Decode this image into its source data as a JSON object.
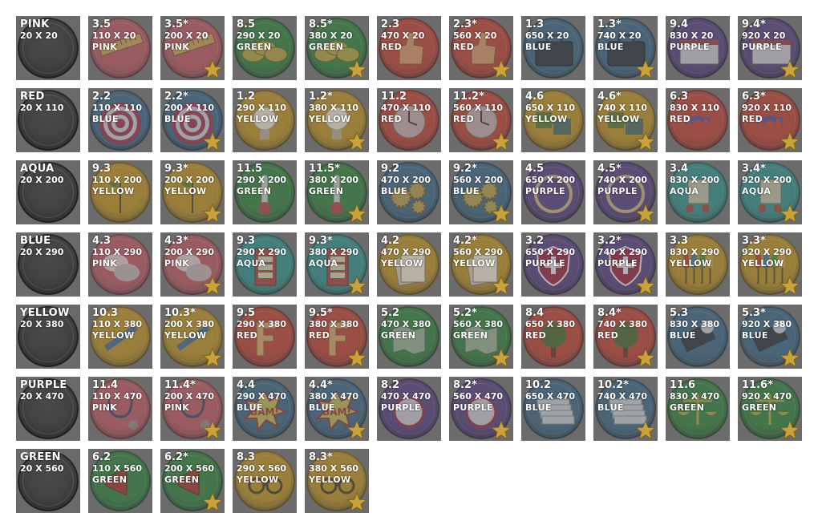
{
  "colors": {
    "tile_bg": "#6a6a6a",
    "PINK": "#b5525a",
    "RED": "#b63a2c",
    "AQUA": "#2c8a86",
    "BLUE": "#35607e",
    "YELLOW": "#b58a1c",
    "PURPLE": "#4f3978",
    "GREEN": "#2a7a36",
    "star": "#c9a23a",
    "empty_disc": "#3a3a3a"
  },
  "rows": [
    {
      "header": {
        "label": "PINK",
        "size": "20 X 20"
      },
      "cells": [
        {
          "code": "3.5",
          "size": "110 X 20",
          "color": "PINK",
          "icon": "ruler-icon"
        },
        {
          "code": "3.5*",
          "size": "200 X 20",
          "color": "PINK",
          "icon": "ruler-icon"
        },
        {
          "code": "8.5",
          "size": "290 X 20",
          "color": "GREEN",
          "icon": "coins-icon"
        },
        {
          "code": "8.5*",
          "size": "380 X 20",
          "color": "GREEN",
          "icon": "coins-icon"
        },
        {
          "code": "2.3",
          "size": "470 X 20",
          "color": "RED",
          "icon": "thumbs-up-icon"
        },
        {
          "code": "2.3*",
          "size": "560 X 20",
          "color": "RED",
          "icon": "thumbs-up-icon"
        },
        {
          "code": "1.3",
          "size": "650 X 20",
          "color": "BLUE",
          "icon": "briefcase-icon"
        },
        {
          "code": "1.3*",
          "size": "740 X 20",
          "color": "BLUE",
          "icon": "briefcase-icon"
        },
        {
          "code": "9.4",
          "size": "830 X 20",
          "color": "PURPLE",
          "icon": "book-icon"
        },
        {
          "code": "9.4*",
          "size": "920 X 20",
          "color": "PURPLE",
          "icon": "book-icon"
        }
      ]
    },
    {
      "header": {
        "label": "RED",
        "size": "20 X 110"
      },
      "cells": [
        {
          "code": "2.2",
          "size": "110 X 110",
          "color": "BLUE",
          "icon": "target-icon"
        },
        {
          "code": "2.2*",
          "size": "200 X 110",
          "color": "BLUE",
          "icon": "target-icon"
        },
        {
          "code": "1.2",
          "size": "290 X 110",
          "color": "YELLOW",
          "icon": "lightbulb-icon"
        },
        {
          "code": "1.2*",
          "size": "380 X 110",
          "color": "YELLOW",
          "icon": "lightbulb-icon"
        },
        {
          "code": "11.2",
          "size": "470 X 110",
          "color": "RED",
          "icon": "clock-icon"
        },
        {
          "code": "11.2*",
          "size": "560 X 110",
          "color": "RED",
          "icon": "clock-icon"
        },
        {
          "code": "4.6",
          "size": "650 X 110",
          "color": "YELLOW",
          "icon": "puzzle-icon"
        },
        {
          "code": "4.6*",
          "size": "740 X 110",
          "color": "YELLOW",
          "icon": "puzzle-icon"
        },
        {
          "code": "6.3",
          "size": "830 X 110",
          "color": "RED",
          "icon": "magnet-icon"
        },
        {
          "code": "6.3*",
          "size": "920 X 110",
          "color": "RED",
          "icon": "magnet-icon"
        }
      ]
    },
    {
      "header": {
        "label": "AQUA",
        "size": "20 X 200"
      },
      "cells": [
        {
          "code": "9.3",
          "size": "110 X 200",
          "color": "YELLOW",
          "icon": "plant-icon"
        },
        {
          "code": "9.3*",
          "size": "200 X 200",
          "color": "YELLOW",
          "icon": "plant-icon"
        },
        {
          "code": "11.5",
          "size": "290 X 200",
          "color": "GREEN",
          "icon": "thermometer-icon"
        },
        {
          "code": "11.5*",
          "size": "380 X 200",
          "color": "GREEN",
          "icon": "thermometer-icon"
        },
        {
          "code": "9.2",
          "size": "470 X 200",
          "color": "BLUE",
          "icon": "gears-icon"
        },
        {
          "code": "9.2*",
          "size": "560 X 200",
          "color": "BLUE",
          "icon": "gears-icon"
        },
        {
          "code": "4.5",
          "size": "650 X 200",
          "color": "PURPLE",
          "icon": "ring-icon"
        },
        {
          "code": "4.5*",
          "size": "740 X 200",
          "color": "PURPLE",
          "icon": "ring-icon"
        },
        {
          "code": "3.4",
          "size": "830 X 200",
          "color": "AQUA",
          "icon": "cart-icon"
        },
        {
          "code": "3.4*",
          "size": "920 X 200",
          "color": "AQUA",
          "icon": "cart-icon"
        }
      ]
    },
    {
      "header": {
        "label": "BLUE",
        "size": "20 X 290"
      },
      "cells": [
        {
          "code": "4.3",
          "size": "110 X 290",
          "color": "PINK",
          "icon": "speech-bubbles-icon"
        },
        {
          "code": "4.3*",
          "size": "200 X 290",
          "color": "PINK",
          "icon": "speech-bubbles-icon"
        },
        {
          "code": "9.3",
          "size": "290 X 290",
          "color": "AQUA",
          "icon": "phone-booth-icon"
        },
        {
          "code": "9.3*",
          "size": "380 X 290",
          "color": "AQUA",
          "icon": "phone-booth-icon"
        },
        {
          "code": "4.2",
          "size": "470 X 290",
          "color": "YELLOW",
          "icon": "documents-icon"
        },
        {
          "code": "4.2*",
          "size": "560 X 290",
          "color": "YELLOW",
          "icon": "documents-icon"
        },
        {
          "code": "3.2",
          "size": "650 X 290",
          "color": "PURPLE",
          "icon": "shield-icon"
        },
        {
          "code": "3.2*",
          "size": "740 X 290",
          "color": "PURPLE",
          "icon": "shield-icon"
        },
        {
          "code": "3.3",
          "size": "830 X 290",
          "color": "YELLOW",
          "icon": "screwdrivers-icon"
        },
        {
          "code": "3.3*",
          "size": "920 X 290",
          "color": "YELLOW",
          "icon": "screwdrivers-icon"
        }
      ]
    },
    {
      "header": {
        "label": "YELLOW",
        "size": "20 X 380"
      },
      "cells": [
        {
          "code": "10.3",
          "size": "110 X 380",
          "color": "YELLOW",
          "icon": "pencil-icon"
        },
        {
          "code": "10.3*",
          "size": "200 X 380",
          "color": "YELLOW",
          "icon": "pencil-icon"
        },
        {
          "code": "9.5",
          "size": "290 X 380",
          "color": "RED",
          "icon": "letter-f-icon"
        },
        {
          "code": "9.5*",
          "size": "380 X 380",
          "color": "RED",
          "icon": "letter-f-icon"
        },
        {
          "code": "5.2",
          "size": "470 X 380",
          "color": "GREEN",
          "icon": "map-icon"
        },
        {
          "code": "5.2*",
          "size": "560 X 380",
          "color": "GREEN",
          "icon": "map-icon"
        },
        {
          "code": "8.4",
          "size": "650 X 380",
          "color": "RED",
          "icon": "tree-icon"
        },
        {
          "code": "8.4*",
          "size": "740 X 380",
          "color": "RED",
          "icon": "tree-icon"
        },
        {
          "code": "5.3",
          "size": "830 X 380",
          "color": "BLUE",
          "icon": "filmstrip-icon"
        },
        {
          "code": "5.3*",
          "size": "920 X 380",
          "color": "BLUE",
          "icon": "filmstrip-icon"
        }
      ]
    },
    {
      "header": {
        "label": "PURPLE",
        "size": "20 X 470"
      },
      "cells": [
        {
          "code": "11.4",
          "size": "110 X 470",
          "color": "PINK",
          "icon": "stethoscope-icon"
        },
        {
          "code": "11.4*",
          "size": "200 X 470",
          "color": "PINK",
          "icon": "stethoscope-icon"
        },
        {
          "code": "4.4",
          "size": "290 X 470",
          "color": "BLUE",
          "icon": "bam-burst-icon",
          "burst_text": "BAM!"
        },
        {
          "code": "4.4*",
          "size": "380 X 470",
          "color": "BLUE",
          "icon": "bam-burst-icon",
          "burst_text": "BAM!"
        },
        {
          "code": "8.2",
          "size": "470 X 470",
          "color": "PURPLE",
          "icon": "alarm-clock-icon"
        },
        {
          "code": "8.2*",
          "size": "560 X 470",
          "color": "PURPLE",
          "icon": "alarm-clock-icon"
        },
        {
          "code": "10.2",
          "size": "650 X 470",
          "color": "BLUE",
          "icon": "paper-stack-icon"
        },
        {
          "code": "10.2*",
          "size": "740 X 470",
          "color": "BLUE",
          "icon": "paper-stack-icon"
        },
        {
          "code": "11.6",
          "size": "830 X 470",
          "color": "GREEN",
          "icon": "scales-icon"
        },
        {
          "code": "11.6*",
          "size": "920 X 470",
          "color": "GREEN",
          "icon": "scales-icon"
        }
      ]
    },
    {
      "header": {
        "label": "GREEN",
        "size": "20 X 560"
      },
      "cells": [
        {
          "code": "6.2",
          "size": "110 X 560",
          "color": "GREEN",
          "icon": "megaphone-icon"
        },
        {
          "code": "6.2*",
          "size": "200 X 560",
          "color": "GREEN",
          "icon": "megaphone-icon"
        },
        {
          "code": "8.3",
          "size": "290 X 560",
          "color": "YELLOW",
          "icon": "glasses-icon"
        },
        {
          "code": "8.3*",
          "size": "380 X 560",
          "color": "YELLOW",
          "icon": "glasses-icon"
        }
      ]
    }
  ]
}
